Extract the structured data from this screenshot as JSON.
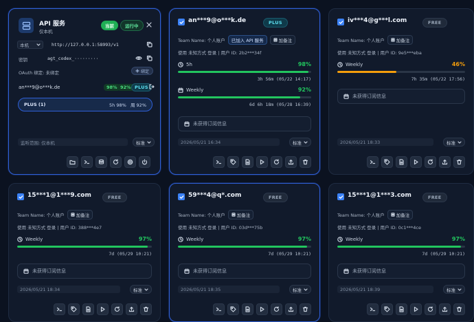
{
  "api_card": {
    "title": "API 服务",
    "subtitle": "仅本机",
    "current_badge": "当前",
    "running_badge": "运行中",
    "scope_select": "本机",
    "url": "http://127.0.0.1:58993/v1",
    "key_label": "密钥",
    "key_value": "agt_codex_·········",
    "oauth_label": "OAuth 绑定: 未绑定",
    "bind_button": "绑定",
    "account": "an***9@o***k.de",
    "pct_a": "98%",
    "pct_b": "92%",
    "plan": "PLUS",
    "plus_box_label": "PLUS (1)",
    "plus_box_stats": "5h 98%   周 92%",
    "listen_label": "监听范围: 仅本机",
    "mode": "标准"
  },
  "accounts": [
    {
      "email": "an***9@o***k.de",
      "plan": "PLUS",
      "team": "Team Name: 个人账户",
      "api_chip": "已加入 API 服务",
      "note_chip": "加备注",
      "usage": "使用 未知方式 登录 | 用户 ID: 2b2***34f",
      "quotas": [
        {
          "label": "5h",
          "pct": "98%",
          "value": 98,
          "color": "#22c55e",
          "reset": "3h 56m (05/22 14:17)",
          "icon": "clock"
        },
        {
          "label": "Weekly",
          "pct": "92%",
          "value": 92,
          "color": "#22c55e",
          "reset": "6d 6h 18m (05/28 16:39)",
          "icon": "calendar"
        }
      ],
      "subscription": "未获得订阅信息",
      "date": "2026/05/21 16:34",
      "mode": "标准"
    },
    {
      "email": "iv***4@g***l.com",
      "plan": "FREE",
      "team": "Team Name: 个人账户",
      "note_chip": "加备注",
      "usage": "使用 未知方式 登录 | 用户 ID: 9e5***eba",
      "quotas": [
        {
          "label": "Weekly",
          "pct": "46%",
          "value": 46,
          "color": "#f59e0b",
          "reset": "7h 35m (05/22 17:56)",
          "icon": "clock"
        }
      ],
      "subscription": "未获得订阅信息",
      "date": "2026/05/21 18:33",
      "mode": "标准"
    },
    {
      "email": "15***1@1***9.com",
      "plan": "FREE",
      "team": "Team Name: 个人账户",
      "note_chip": "加备注",
      "usage": "使用 未知方式 登录 | 用户 ID: 388***4e7",
      "quotas": [
        {
          "label": "Weekly",
          "pct": "97%",
          "value": 97,
          "color": "#22c55e",
          "reset": "7d (05/29 10:21)",
          "icon": "clock"
        }
      ],
      "subscription": "未获得订阅信息",
      "date": "2026/05/21 18:34",
      "mode": "标准"
    },
    {
      "email": "59***4@q*.com",
      "plan": "FREE",
      "team": "Team Name: 个人账户",
      "note_chip": "加备注",
      "usage": "使用 未知方式 登录 | 用户 ID: 03d***75b",
      "quotas": [
        {
          "label": "Weekly",
          "pct": "97%",
          "value": 97,
          "color": "#22c55e",
          "reset": "7d (05/29 10:21)",
          "icon": "clock"
        }
      ],
      "subscription": "未获得订阅信息",
      "date": "2026/05/21 18:35",
      "mode": "标准"
    },
    {
      "email": "15***1@1***3.com",
      "plan": "FREE",
      "team": "Team Name: 个人账户",
      "note_chip": "加备注",
      "usage": "使用 未知方式 登录 | 用户 ID: 0c1***4ce",
      "quotas": [
        {
          "label": "Weekly",
          "pct": "97%",
          "value": 97,
          "color": "#22c55e",
          "reset": "7d (05/29 10:21)",
          "icon": "clock"
        }
      ],
      "subscription": "未获得订阅信息",
      "date": "2026/05/21 18:39",
      "mode": "标准"
    }
  ]
}
